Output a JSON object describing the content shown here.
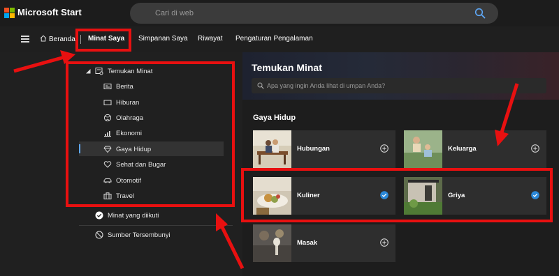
{
  "app": {
    "brand": "Microsoft Start"
  },
  "search": {
    "placeholder": "Cari di web"
  },
  "nav": {
    "home": "Beranda",
    "items": [
      "Minat Saya",
      "Simpanan Saya",
      "Riwayat",
      "Pengaturan Pengalaman"
    ]
  },
  "sidebar": {
    "group": "Temukan Minat",
    "items": [
      {
        "label": "Berita",
        "icon": "newspaper-icon"
      },
      {
        "label": "Hiburan",
        "icon": "tv-icon"
      },
      {
        "label": "Olahraga",
        "icon": "ball-icon"
      },
      {
        "label": "Ekonomi",
        "icon": "chart-icon"
      },
      {
        "label": "Gaya Hidup",
        "icon": "diamond-icon",
        "active": true
      },
      {
        "label": "Sehat dan Bugar",
        "icon": "heart-icon"
      },
      {
        "label": "Otomotif",
        "icon": "car-icon"
      },
      {
        "label": "Travel",
        "icon": "suitcase-icon"
      }
    ],
    "followed": "Minat yang diikuti",
    "hidden": "Sumber Tersembunyi"
  },
  "main": {
    "title": "Temukan Minat",
    "search_placeholder": "Apa yang ingin Anda lihat di umpan Anda?",
    "section": "Gaya Hidup",
    "cards": [
      {
        "label": "Hubungan",
        "followed": false
      },
      {
        "label": "Keluarga",
        "followed": false
      },
      {
        "label": "Kuliner",
        "followed": true
      },
      {
        "label": "Griya",
        "followed": true
      },
      {
        "label": "Masak",
        "followed": false
      }
    ]
  },
  "colors": {
    "accent": "#5ea7f5",
    "annotation": "#e81010",
    "check": "#2b88d8"
  }
}
